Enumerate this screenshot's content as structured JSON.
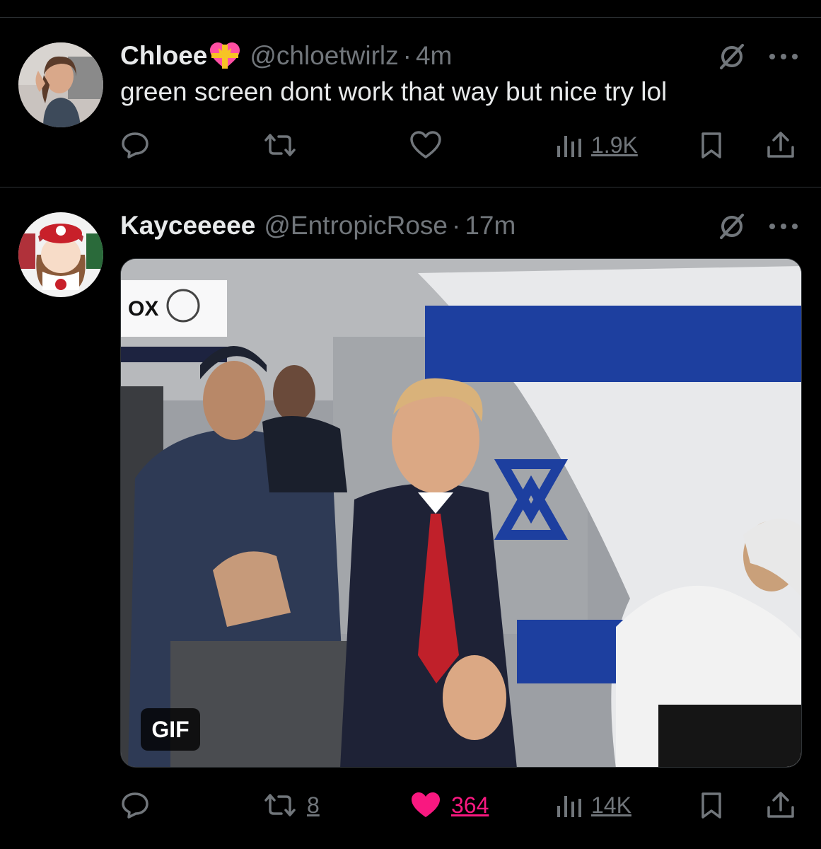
{
  "tweets": [
    {
      "display_name": "Chloee",
      "handle": "@chloetwirlz",
      "separator": "·",
      "time": "4m",
      "text": "green screen dont work that way but nice try lol",
      "avatar_icon": "user-avatar-chloe",
      "badge_icon": "heart-with-ribbon-emoji",
      "actions": {
        "reply_count": "",
        "repost_count": "",
        "like_count": "",
        "views": "1.9K"
      }
    },
    {
      "display_name": "Kayceeeee",
      "handle": "@EntropicRose",
      "separator": "·",
      "time": "17m",
      "avatar_icon": "user-avatar-kaycee",
      "media": {
        "type": "gif",
        "badge_label": "GIF",
        "overlay_logo": "OX"
      },
      "actions": {
        "reply_count": "",
        "repost_count": "8",
        "like_count": "364",
        "liked": true,
        "views": "14K"
      }
    }
  ],
  "colors": {
    "background": "#000000",
    "text_primary": "#e7e9ea",
    "text_secondary": "#71767b",
    "divider": "#2f3336",
    "like_active": "#f91880"
  }
}
